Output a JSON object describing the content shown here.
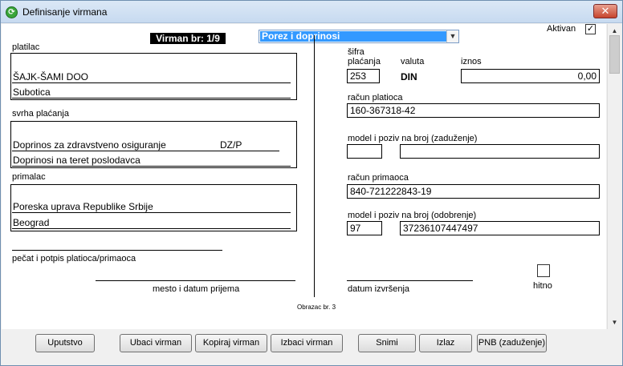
{
  "window": {
    "title": "Definisanje virmana",
    "icon": "app-icon",
    "close_label": "✕"
  },
  "header": {
    "virman_no": "Virman br: 1/9",
    "combo_value": "Porez i doprinosi",
    "aktivan_label": "Aktivan",
    "aktivan_checked": "✓"
  },
  "left": {
    "platilac_label": "platilac",
    "platilac_line1": "ŠAJK-ŠAMI DOO",
    "platilac_line2": "Subotica",
    "svrha_label": "svrha plaćanja",
    "svrha_line1": "Doprinos za zdravstveno osiguranje",
    "svrha_code": "DZ/P",
    "svrha_line2": "Doprinosi na teret poslodavca",
    "primalac_label": "primalac",
    "primalac_line1": "Poreska uprava Republike Srbije",
    "primalac_line2": "Beograd",
    "pecat_label": "pečat i potpis platioca/primaoca",
    "mesto_label": "mesto i datum prijema"
  },
  "right": {
    "sifra_label_1": "šifra",
    "sifra_label_2": "plaćanja",
    "valuta_label": "valuta",
    "iznos_label": "iznos",
    "sifra_value": "253",
    "valuta_value": "DIN",
    "iznos_value": "0,00",
    "racun_platioca_label": "račun platioca",
    "racun_platioca_value": "160-367318-42",
    "model_zaduzenje_label": "model i poziv na broj (zaduženje)",
    "model_zaduzenje_model": "",
    "model_zaduzenje_poziv": "",
    "racun_primaoca_label": "račun primaoca",
    "racun_primaoca_value": "840-721222843-19",
    "model_odobrenje_label": "model i poziv na broj (odobrenje)",
    "model_odobrenje_model": "97",
    "model_odobrenje_poziv": "37236107447497",
    "datum_label": "datum izvršenja",
    "hitno_label": "hitno"
  },
  "footer_note": "Obrazac br. 3",
  "buttons": {
    "uputstvo": "Uputstvo",
    "ubaci": "Ubaci virman",
    "kopiraj": "Kopiraj virman",
    "izbaci": "Izbaci virman",
    "snimi": "Snimi",
    "izlaz": "Izlaz",
    "pnb": "PNB (zaduženje)"
  },
  "colors": {
    "selection": "#3399ff",
    "titlebar": "#c7daf0",
    "close": "#c7442d"
  }
}
